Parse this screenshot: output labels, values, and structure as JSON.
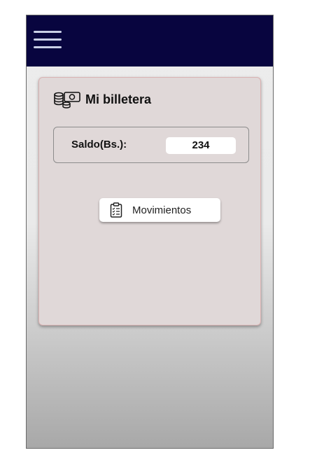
{
  "card": {
    "title": "Mi billetera"
  },
  "balance": {
    "label": "Saldo(Bs.):",
    "value": "234"
  },
  "actions": {
    "movements_label": "Movimientos"
  },
  "icons": {
    "menu": "hamburger-menu-icon",
    "wallet": "money-wallet-icon",
    "movements": "clipboard-list-icon"
  },
  "colors": {
    "topbar": "#08053f",
    "card": "#e0d8d8"
  }
}
